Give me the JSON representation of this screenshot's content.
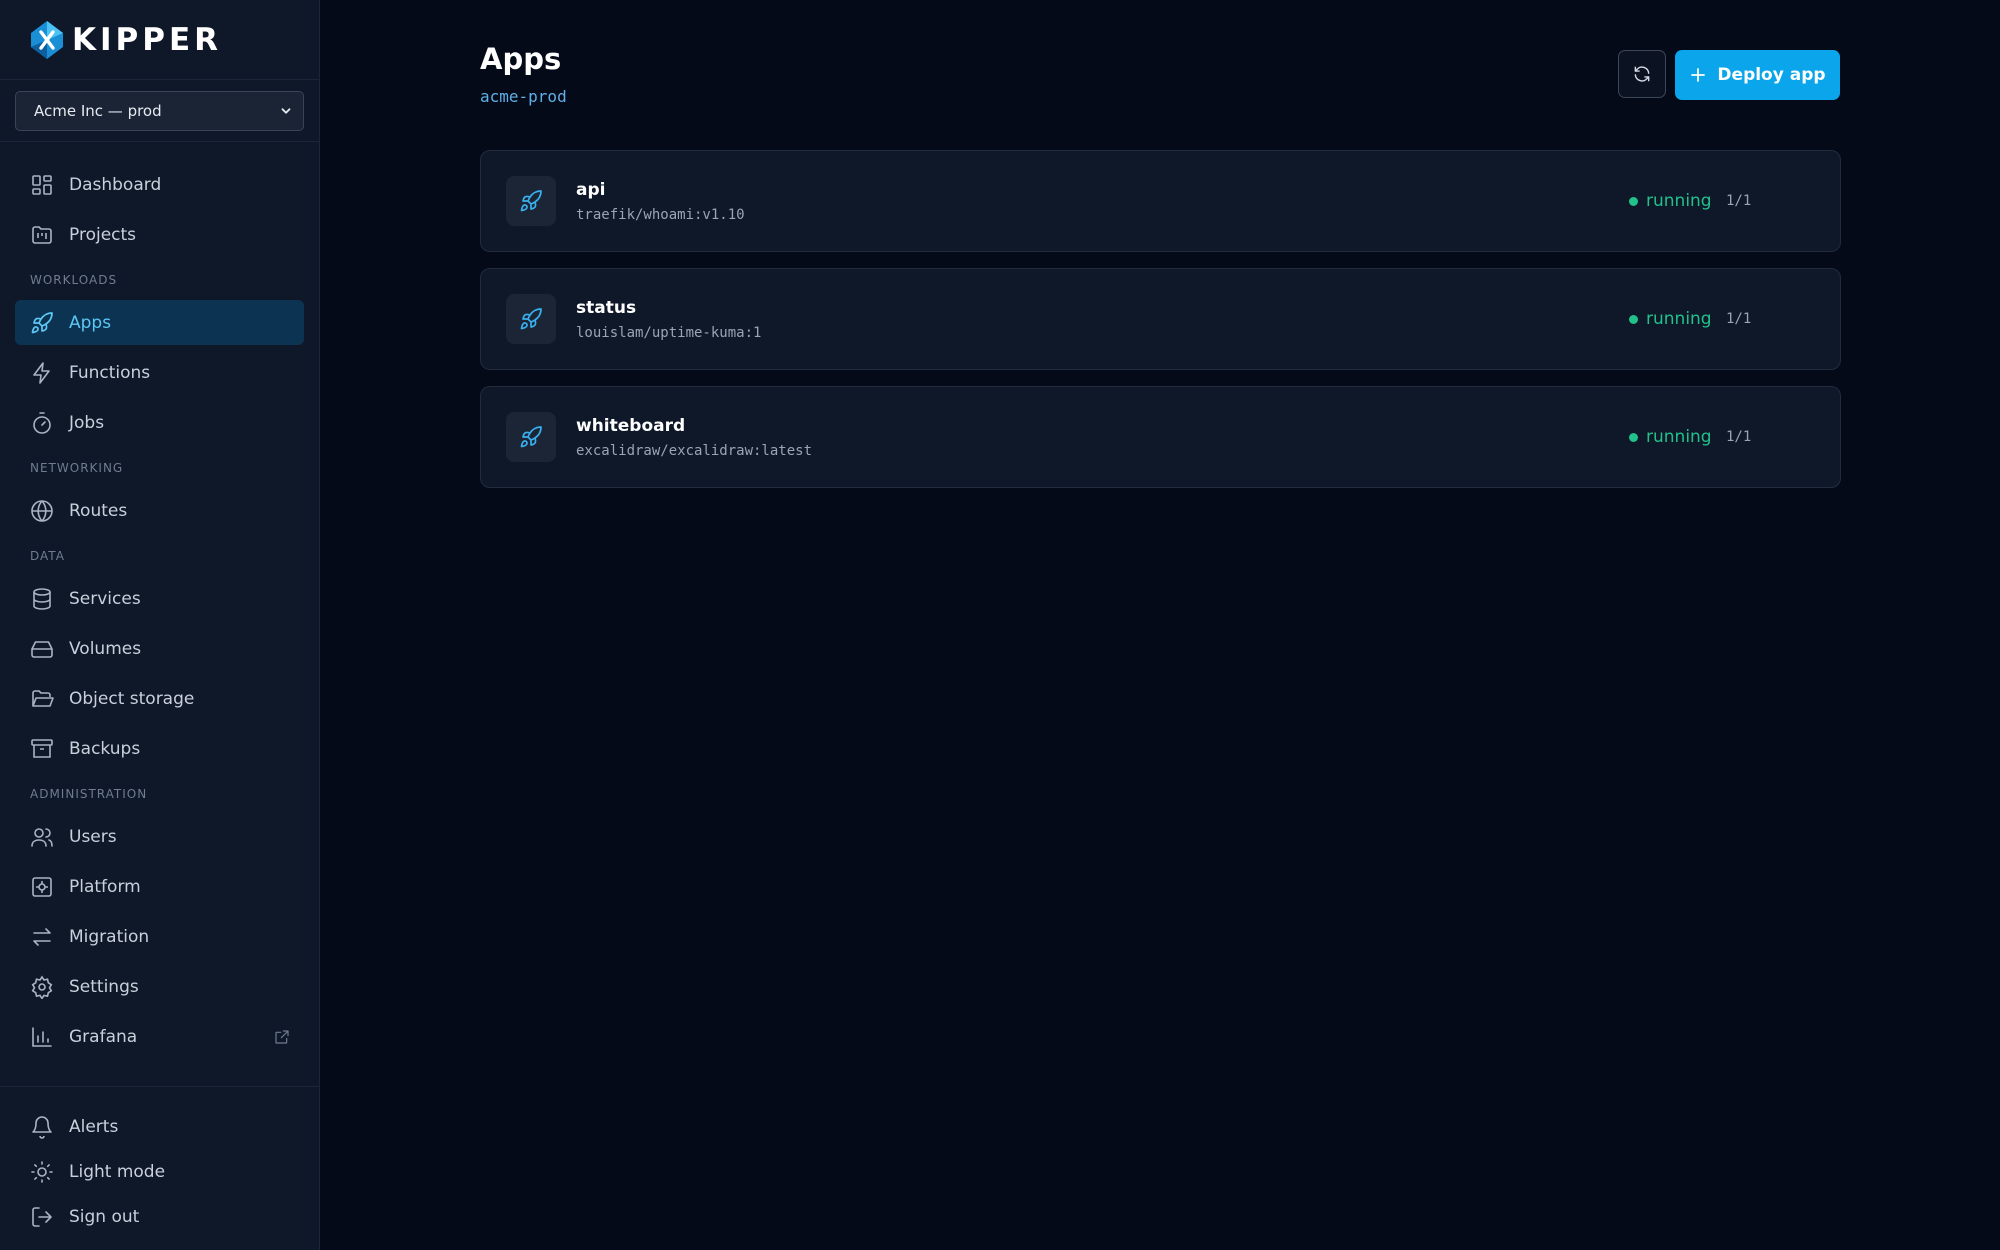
{
  "brand": {
    "name": "KIPPER"
  },
  "org_select": {
    "value": "Acme Inc — prod"
  },
  "sidebar": {
    "top_items": [
      {
        "label": "Dashboard",
        "icon": "dashboard-icon"
      },
      {
        "label": "Projects",
        "icon": "folder-kanban-icon"
      }
    ],
    "sections": [
      {
        "title": "WORKLOADS",
        "items": [
          {
            "label": "Apps",
            "icon": "rocket-icon",
            "active": true
          },
          {
            "label": "Functions",
            "icon": "lightning-icon"
          },
          {
            "label": "Jobs",
            "icon": "timer-icon"
          }
        ]
      },
      {
        "title": "NETWORKING",
        "items": [
          {
            "label": "Routes",
            "icon": "globe-icon"
          }
        ]
      },
      {
        "title": "DATA",
        "items": [
          {
            "label": "Services",
            "icon": "database-icon"
          },
          {
            "label": "Volumes",
            "icon": "hard-drive-icon"
          },
          {
            "label": "Object storage",
            "icon": "folder-open-icon"
          },
          {
            "label": "Backups",
            "icon": "archive-icon"
          }
        ]
      },
      {
        "title": "ADMINISTRATION",
        "items": [
          {
            "label": "Users",
            "icon": "users-icon"
          },
          {
            "label": "Platform",
            "icon": "platform-icon"
          },
          {
            "label": "Migration",
            "icon": "arrows-swap-icon"
          },
          {
            "label": "Settings",
            "icon": "gear-icon"
          },
          {
            "label": "Grafana",
            "icon": "bar-chart-icon",
            "external": true
          }
        ]
      }
    ],
    "bottom_items": [
      {
        "label": "Alerts",
        "icon": "bell-icon"
      },
      {
        "label": "Light mode",
        "icon": "sun-icon"
      },
      {
        "label": "Sign out",
        "icon": "sign-out-icon"
      }
    ]
  },
  "header": {
    "title": "Apps",
    "context": "acme-prod",
    "deploy_label": "Deploy app"
  },
  "apps": [
    {
      "name": "api",
      "image": "traefik/whoami:v1.10",
      "status": "running",
      "replicas": "1/1"
    },
    {
      "name": "status",
      "image": "louislam/uptime-kuma:1",
      "status": "running",
      "replicas": "1/1"
    },
    {
      "name": "whiteboard",
      "image": "excalidraw/excalidraw:latest",
      "status": "running",
      "replicas": "1/1"
    }
  ],
  "colors": {
    "accent": "#0aa5ea",
    "active_bg": "#0c3452",
    "status_running": "#22c08a",
    "background": "#050a18",
    "sidebar_bg": "#0f1828"
  }
}
